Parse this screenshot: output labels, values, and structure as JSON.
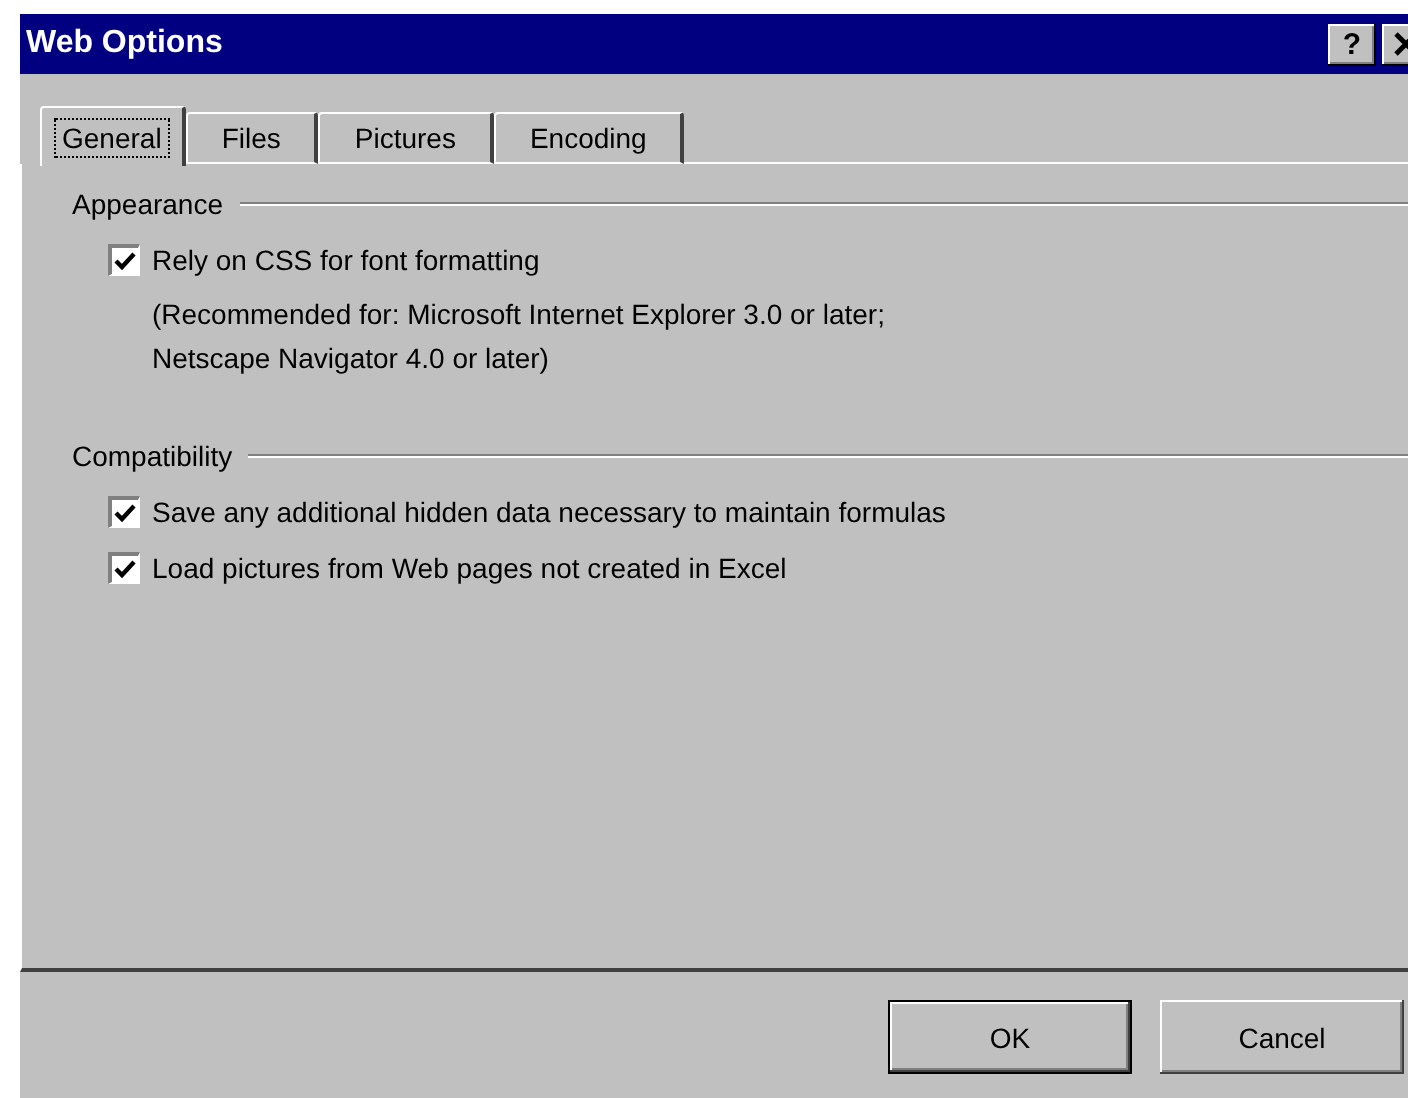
{
  "window": {
    "title": "Web Options",
    "help_button": "?"
  },
  "tabs": [
    {
      "label": "General",
      "selected": true
    },
    {
      "label": "Files",
      "selected": false
    },
    {
      "label": "Pictures",
      "selected": false
    },
    {
      "label": "Encoding",
      "selected": false
    }
  ],
  "groups": [
    {
      "title": "Appearance",
      "options": [
        {
          "label": "Rely on CSS for font formatting",
          "checked": true,
          "note": "(Recommended for: Microsoft Internet Explorer 3.0 or later;\nNetscape Navigator 4.0 or later)"
        }
      ]
    },
    {
      "title": "Compatibility",
      "options": [
        {
          "label": "Save any additional hidden data necessary to maintain formulas",
          "checked": true
        },
        {
          "label": "Load pictures from Web pages not created in Excel",
          "checked": true
        }
      ]
    }
  ],
  "buttons": [
    {
      "label": "OK",
      "default": true
    },
    {
      "label": "Cancel",
      "default": false
    }
  ]
}
